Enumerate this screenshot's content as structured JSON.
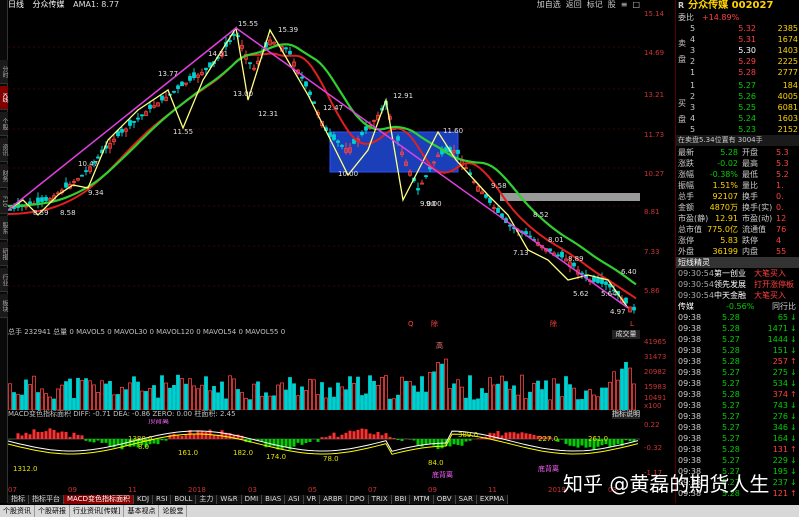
{
  "left_tabs": [
    "分时",
    "K线",
    "个股",
    "资讯",
    "财务",
    "F10",
    "股东",
    "研报",
    "行业",
    "板块"
  ],
  "toolbar": {
    "period": "日线",
    "name": "分众传媒",
    "ama": "AMA1: 8.77"
  },
  "window_buttons": [
    "加自选",
    "返回",
    "标记",
    "股",
    "≡",
    "□"
  ],
  "price_axis": [
    "15.14",
    "14.69",
    "13.21",
    "11.73",
    "10.27",
    "8.81",
    "7.33",
    "5.86"
  ],
  "main_annotations": [
    "15.55",
    "15.39",
    "14.51",
    "13.77",
    "13.00",
    "12.47",
    "12.31",
    "12.91",
    "11.60",
    "11.55",
    "10.47",
    "10.00",
    "9.58",
    "9.00",
    "8.52",
    "8.89",
    "8.01",
    "7.13",
    "6.40",
    "5.62",
    "5.64",
    "4.97",
    "9.34",
    "8.58",
    "8.59",
    "9.00"
  ],
  "main_flags": {
    "a": "Q",
    "b": "除",
    "c": "除",
    "d": "L"
  },
  "volume": {
    "legend": "总手 232941 总量 0 MAVOL5 0 MAVOL30 0 MAVOL120 0 MAVOL54 0 MAVOL55 0",
    "unit_button": "成交量",
    "axis": [
      "41965",
      "31473",
      "20982",
      "15983",
      "10491",
      "x100"
    ],
    "peak": "高"
  },
  "macd": {
    "legend": "MACD变色指标面积 DIFF: -0.71 DEA: -0.86 ZERO: 0.00 柱面积: 2.45",
    "button": "指标说明",
    "axis": [
      "0.22",
      "-0.32",
      "-1.17"
    ],
    "labels": [
      "1312.0",
      "1380.0",
      "8.0",
      "161.0",
      "182.0",
      "174.0",
      "78.0",
      "84.0",
      "389.0",
      "227.0",
      "261.0",
      "顶背离",
      "底背离",
      "底背离"
    ]
  },
  "date_axis": [
    "07",
    "09",
    "11",
    "2018",
    "03",
    "05",
    "07",
    "09",
    "11",
    "2019",
    "03"
  ],
  "bottom_tabs": [
    "指标",
    "指标平台",
    "MACD变色指标面积",
    "KDJ",
    "RSI",
    "BOLL",
    "主力",
    "W&R",
    "DMI",
    "BIAS",
    "ASI",
    "VR",
    "ARBR",
    "DPO",
    "TRIX",
    "BBI",
    "MTM",
    "OBV",
    "SAR",
    "EXPMA"
  ],
  "bottom_bar": [
    "个股资讯",
    "个股研报",
    "行业资讯[传媒]",
    "基本视点",
    "论股堂"
  ],
  "quote": {
    "code": "R",
    "name_line": "分众传媒 002027",
    "weibi": {
      "label": "委比",
      "value": "+14.89%"
    },
    "sell": [
      [
        "5",
        "5.32",
        "2385"
      ],
      [
        "4",
        "5.31",
        "1674"
      ],
      [
        "3",
        "5.30",
        "1403"
      ],
      [
        "2",
        "5.29",
        "2225"
      ],
      [
        "1",
        "5.28",
        "2777"
      ]
    ],
    "sell_side": "卖盘",
    "buy_side": "买盘",
    "buy": [
      [
        "1",
        "5.27",
        "184"
      ],
      [
        "2",
        "5.26",
        "4005"
      ],
      [
        "3",
        "5.25",
        "6081"
      ],
      [
        "4",
        "5.24",
        "1603"
      ],
      [
        "5",
        "5.23",
        "2152"
      ]
    ],
    "info_tabs": "在卖盘5.34位置有 3004手",
    "stats": [
      [
        "最新",
        "5.28",
        "开盘",
        "5.3"
      ],
      [
        "涨跌",
        "-0.02",
        "最高",
        "5.3"
      ],
      [
        "涨幅",
        "-0.38%",
        "最低",
        "5.2"
      ],
      [
        "振幅",
        "1.51%",
        "量比",
        "1."
      ],
      [
        "总手",
        "92107",
        "换手",
        "0."
      ],
      [
        "金额",
        "4870万",
        "换手(实)",
        "0."
      ],
      [
        "市盈(静)",
        "12.91",
        "市盈(动)",
        "12"
      ],
      [
        "总市值",
        "775.0亿",
        "流通值",
        "76"
      ],
      [
        "涨停",
        "5.83",
        "跌停",
        "4"
      ],
      [
        "外盘",
        "36199",
        "内盘",
        "55"
      ]
    ],
    "news_header": "短线精灵",
    "news": [
      [
        "09:30:54",
        "第一创业",
        "大笔买入"
      ],
      [
        "09:30:54",
        "领先发展",
        "打开涨停板"
      ],
      [
        "09:30:54",
        "中天金融",
        "大笔买入"
      ]
    ],
    "sector": [
      "传媒",
      "-0.56%",
      "同行比"
    ],
    "ticks": [
      [
        "09:38",
        "5.28",
        "65",
        "↓"
      ],
      [
        "09:38",
        "5.28",
        "1471",
        "↓"
      ],
      [
        "09:38",
        "5.27",
        "1444",
        "↓"
      ],
      [
        "09:38",
        "5.28",
        "151",
        "↓"
      ],
      [
        "09:38",
        "5.28",
        "257",
        "↑"
      ],
      [
        "09:38",
        "5.27",
        "275",
        "↓"
      ],
      [
        "09:38",
        "5.27",
        "534",
        "↓"
      ],
      [
        "09:38",
        "5.28",
        "374",
        "↑"
      ],
      [
        "09:38",
        "5.27",
        "743",
        "↓"
      ],
      [
        "09:38",
        "5.27",
        "276",
        "↓"
      ],
      [
        "09:38",
        "5.27",
        "346",
        "↓"
      ],
      [
        "09:38",
        "5.27",
        "164",
        "↓"
      ],
      [
        "09:38",
        "5.28",
        "131",
        "↑"
      ],
      [
        "09:38",
        "5.27",
        "229",
        "↓"
      ],
      [
        "09:38",
        "5.27",
        "195",
        "↓"
      ],
      [
        "09:38",
        "5.27",
        "237",
        "↓"
      ],
      [
        "09:38",
        "5.28",
        "121",
        "↑"
      ],
      [
        "09:38",
        "5.27",
        "237",
        "↓"
      ]
    ]
  },
  "watermark": "知乎 @黄磊的期货人生",
  "colors": {
    "up": "#ff3030",
    "down": "#00c000",
    "zigzag": "#e040e0",
    "price": "#ffff80",
    "ma_red": "#e02020",
    "ma_green": "#30d030",
    "box": "#1a3fb8"
  }
}
